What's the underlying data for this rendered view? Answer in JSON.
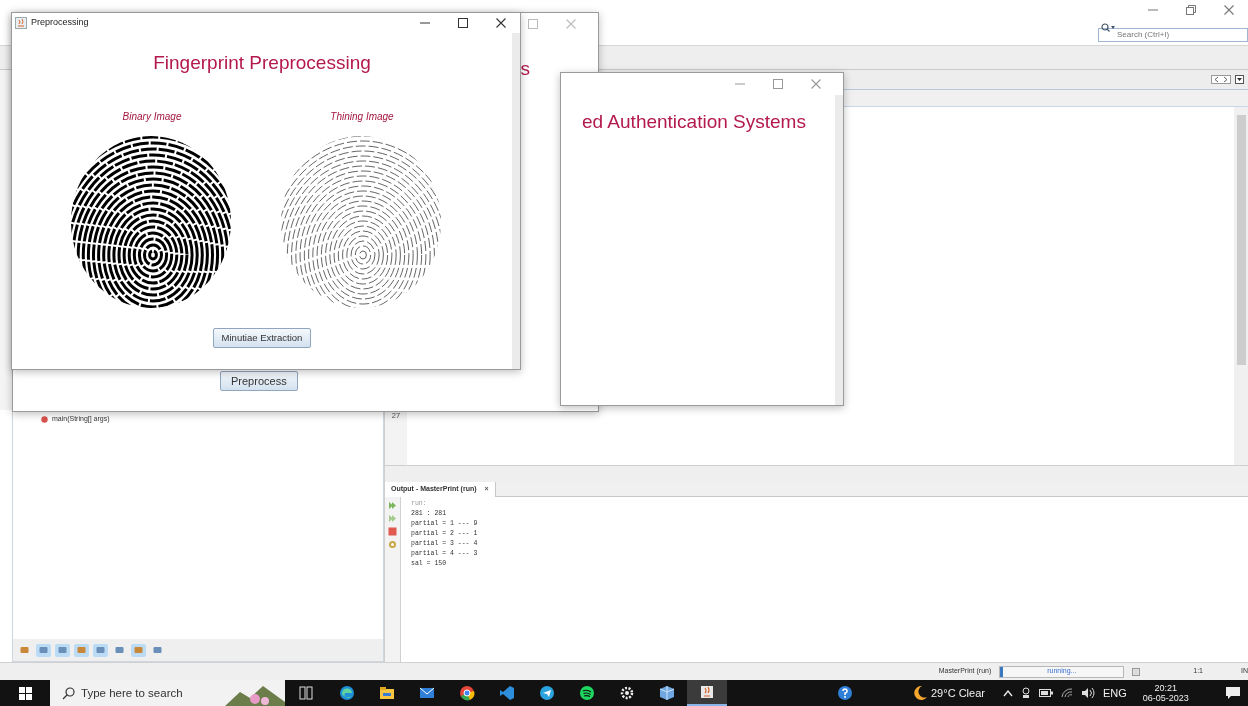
{
  "ide": {
    "search": {
      "placeholder": "Search (Ctrl+I)"
    },
    "editor": {
      "line_number": "27"
    },
    "navigator": {
      "items": [
        {
          "label": "main(String[] args)"
        }
      ],
      "filters": [
        {
          "selected": false
        },
        {
          "selected": true
        },
        {
          "selected": true
        },
        {
          "selected": true
        },
        {
          "selected": true
        },
        {
          "selected": false
        },
        {
          "selected": true
        },
        {
          "selected": false
        }
      ]
    },
    "output": {
      "tab": {
        "label": "Output - MasterPrint (run)",
        "close": "×"
      },
      "lines": [
        {
          "text": "run:",
          "dim": true
        },
        {
          "text": "281 : 281",
          "dim": false
        },
        {
          "text": "partial = 1 --- 9",
          "dim": false
        },
        {
          "text": "partial = 2 --- 1",
          "dim": false
        },
        {
          "text": "partial = 3 --- 4",
          "dim": false
        },
        {
          "text": "partial = 4 --- 3",
          "dim": false
        },
        {
          "text": "sal = 150",
          "dim": false
        }
      ]
    },
    "status_bar": {
      "task": "MasterPrint (run)",
      "progress_label": "running...",
      "level": 0.02,
      "position": "1:1",
      "mode": "IN"
    }
  },
  "back_window": {
    "heading_fragment": "s",
    "button": "Preprocess"
  },
  "auth_window": {
    "heading_fragment": "ed Authentication Systems"
  },
  "preprocessing_window": {
    "title": "Preprocessing",
    "heading": "Fingerprint Preprocessing",
    "images": [
      {
        "caption": "Binary Image",
        "kind": "binary"
      },
      {
        "caption": "Thining Image",
        "kind": "thinned"
      }
    ],
    "button": "Minutiae Extraction"
  },
  "taskbar": {
    "search": {
      "placeholder": "Type here to search"
    },
    "apps": [
      {
        "kind": "task-view",
        "selected": false
      },
      {
        "kind": "edge",
        "selected": false
      },
      {
        "kind": "files",
        "selected": false
      },
      {
        "kind": "mail",
        "selected": false
      },
      {
        "kind": "chrome",
        "selected": false
      },
      {
        "kind": "vscode",
        "selected": false
      },
      {
        "kind": "telegram",
        "selected": false
      },
      {
        "kind": "spotify",
        "selected": false
      },
      {
        "kind": "settings",
        "selected": false
      },
      {
        "kind": "box",
        "selected": false
      },
      {
        "kind": "java",
        "selected": true
      }
    ],
    "weather": "29°C Clear",
    "language": "ENG",
    "time": "20:21",
    "date": "06-05-2023"
  }
}
